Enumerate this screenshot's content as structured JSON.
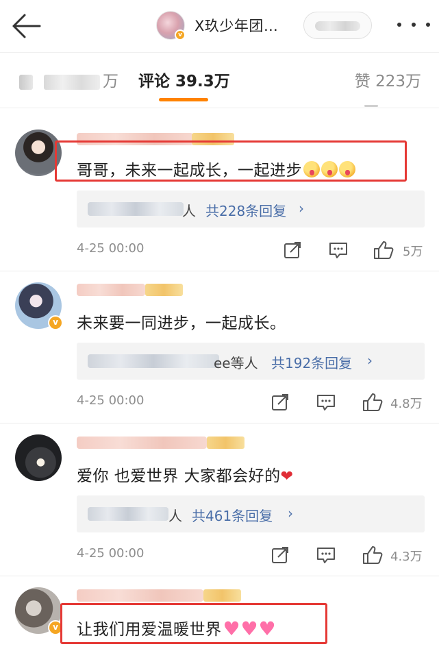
{
  "header": {
    "back_label": "",
    "account_name": "X玖少年团…",
    "more_label": ""
  },
  "tabs": {
    "repost_suffix": "万",
    "comments_label": "评论 39.3万",
    "likes_label": "赞 223万"
  },
  "comments": [
    {
      "text": "哥哥，未来一起成长，一起进步",
      "emojis": [
        "blush-emoji",
        "blush-emoji",
        "blush-emoji"
      ],
      "replies_people_suffix": "人",
      "replies_count": "共228条回复",
      "timestamp": "4-25 00:00",
      "likes": "5万",
      "highlighted": true
    },
    {
      "text": "未来要一同进步，一起成长。",
      "replies_people_suffix": "ee等人",
      "replies_count": "共192条回复",
      "timestamp": "4-25 00:00",
      "likes": "4.8万",
      "verified": true
    },
    {
      "text": "爱你 也爱世界 大家都会好的",
      "emoji_heart": "❤",
      "replies_people_suffix": "人",
      "replies_count": "共461条回复",
      "timestamp": "4-25 00:00",
      "likes": "4.3万"
    },
    {
      "text": "让我们用爱温暖世界",
      "emojis": [
        "sparkling-heart-emoji",
        "sparkling-heart-emoji",
        "sparkling-heart-emoji"
      ],
      "verified": true,
      "highlighted": true
    }
  ],
  "colors": {
    "accent_orange": "#ff8200",
    "highlight_red": "#e53935",
    "link_blue": "#4a6ea8",
    "verified_gold": "#f5a623"
  },
  "icons": [
    "back-arrow-icon",
    "more-dots-icon",
    "verified-badge-icon",
    "repost-icon",
    "comment-icon",
    "like-thumb-icon"
  ]
}
